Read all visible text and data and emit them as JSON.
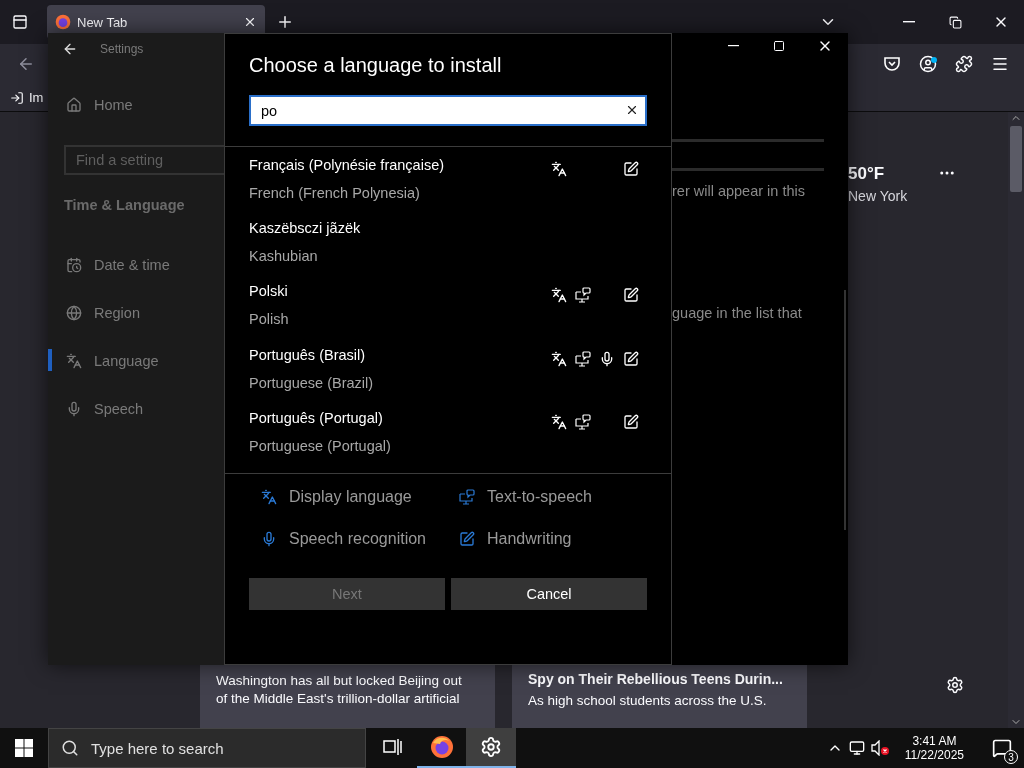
{
  "browser": {
    "tabs": [
      {
        "label": "New Tab",
        "selected": true
      }
    ],
    "bookmarks": [
      {
        "label": "Im"
      }
    ],
    "weather": {
      "temperature": "50°F",
      "city": "New York"
    },
    "news_cards": [
      {
        "lines": [
          "Washington has all but locked Beijing out",
          "of the Middle East's trillion-dollar artificial"
        ]
      },
      {
        "headline": "Spy on Their Rebellious Teens Durin...",
        "lines": [
          "As high school students across the U.S."
        ]
      }
    ]
  },
  "settings": {
    "title": "Settings",
    "home": "Home",
    "search": {
      "placeholder": "Find a setting"
    },
    "section": "Time & Language",
    "nav": [
      {
        "kind": "date",
        "label": "Date & time",
        "selected": false
      },
      {
        "kind": "region",
        "label": "Region",
        "selected": false
      },
      {
        "kind": "language",
        "label": "Language",
        "selected": true
      },
      {
        "kind": "speech",
        "label": "Speech",
        "selected": false
      }
    ],
    "pane_texts": [
      "rer will appear in this",
      "guage in the list that"
    ]
  },
  "dialog": {
    "title": "Choose a language to install",
    "search": {
      "value": "po"
    },
    "languages": [
      {
        "native": "Français (Polynésie française)",
        "english": "French (French Polynesia)",
        "display": true,
        "tts": false,
        "speech": false,
        "handwriting": true
      },
      {
        "native": "Kaszëbsczi jãzëk",
        "english": "Kashubian",
        "display": false,
        "tts": false,
        "speech": false,
        "handwriting": false
      },
      {
        "native": "Polski",
        "english": "Polish",
        "display": true,
        "tts": true,
        "speech": false,
        "handwriting": true
      },
      {
        "native": "Português (Brasil)",
        "english": "Portuguese (Brazil)",
        "display": true,
        "tts": true,
        "speech": true,
        "handwriting": true
      },
      {
        "native": "Português (Portugal)",
        "english": "Portuguese (Portugal)",
        "display": true,
        "tts": true,
        "speech": false,
        "handwriting": true
      }
    ],
    "legend": [
      {
        "kind": "display",
        "label": "Display language"
      },
      {
        "kind": "tts",
        "label": "Text-to-speech"
      },
      {
        "kind": "speech",
        "label": "Speech recognition"
      },
      {
        "kind": "handwriting",
        "label": "Handwriting"
      }
    ],
    "buttons": [
      {
        "label": "Next",
        "disabled": true
      },
      {
        "label": "Cancel",
        "disabled": false
      }
    ]
  },
  "taskbar": {
    "search": {
      "placeholder": "Type here to search"
    },
    "apps": [
      {
        "kind": "taskview",
        "open": false,
        "selected": false
      },
      {
        "kind": "firefox",
        "open": true,
        "selected": false
      },
      {
        "kind": "settings",
        "open": true,
        "selected": true
      }
    ],
    "time": "3:41 AM",
    "date": "11/22/2025",
    "notification_count": "3"
  }
}
